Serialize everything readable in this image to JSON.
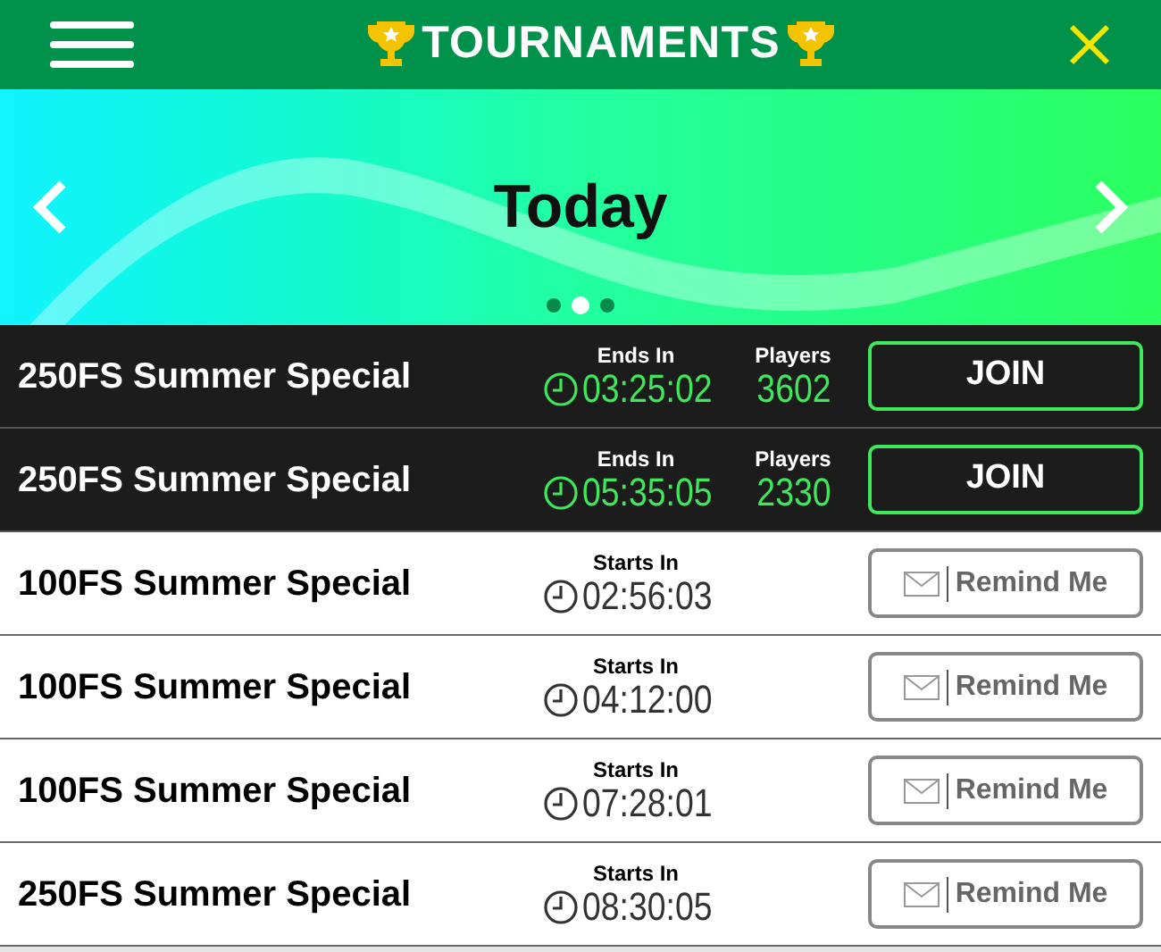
{
  "header": {
    "title": "TOURNAMENTS"
  },
  "banner": {
    "title": "Today",
    "pages": [
      {
        "selected": false
      },
      {
        "selected": true
      },
      {
        "selected": false
      }
    ]
  },
  "tournaments": [
    {
      "kind": "live",
      "name": "250FS Summer Special",
      "time_label": "Ends In",
      "time": "03:25:02",
      "players_label": "Players",
      "players": "3602",
      "action": "JOIN"
    },
    {
      "kind": "live",
      "name": "250FS Summer Special",
      "time_label": "Ends In",
      "time": "05:35:05",
      "players_label": "Players",
      "players": "2330",
      "action": "JOIN"
    },
    {
      "kind": "upcoming",
      "name": "100FS Summer Special",
      "time_label": "Starts In",
      "time": "02:56:03",
      "action": "Remind Me"
    },
    {
      "kind": "upcoming",
      "name": "100FS Summer Special",
      "time_label": "Starts In",
      "time": "04:12:00",
      "action": "Remind Me"
    },
    {
      "kind": "upcoming",
      "name": "100FS Summer Special",
      "time_label": "Starts In",
      "time": "07:28:01",
      "action": "Remind Me"
    },
    {
      "kind": "upcoming",
      "name": "250FS Summer Special",
      "time_label": "Starts In",
      "time": "08:30:05",
      "action": "Remind Me"
    }
  ]
}
